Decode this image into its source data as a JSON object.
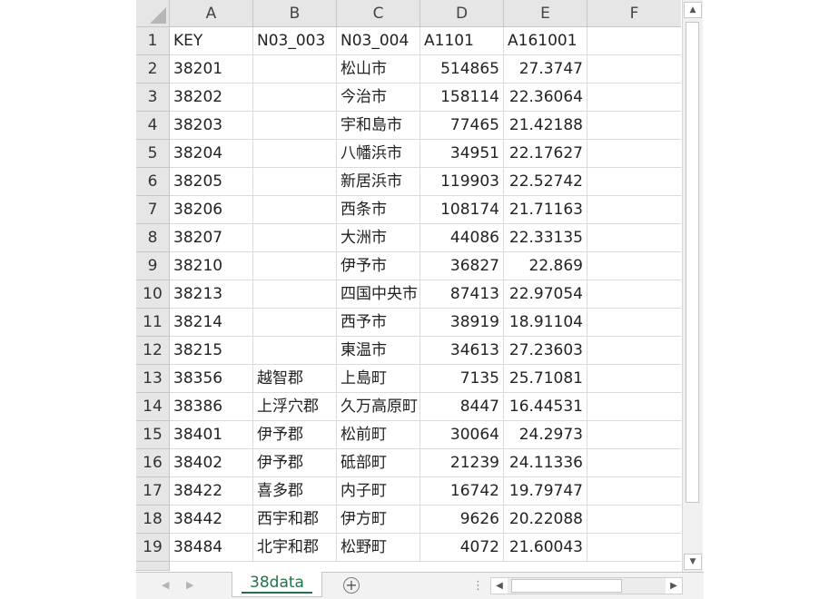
{
  "spreadsheet": {
    "columns": [
      "A",
      "B",
      "C",
      "D",
      "E",
      "F"
    ],
    "rows": [
      {
        "num": "1",
        "a": "KEY",
        "b": "N03_003",
        "c": "N03_004",
        "d": "A1101",
        "e": "A161001"
      },
      {
        "num": "2",
        "a": "38201",
        "b": "",
        "c": "松山市",
        "d": "514865",
        "e": "27.3747"
      },
      {
        "num": "3",
        "a": "38202",
        "b": "",
        "c": "今治市",
        "d": "158114",
        "e": "22.36064"
      },
      {
        "num": "4",
        "a": "38203",
        "b": "",
        "c": "宇和島市",
        "d": "77465",
        "e": "21.42188"
      },
      {
        "num": "5",
        "a": "38204",
        "b": "",
        "c": "八幡浜市",
        "d": "34951",
        "e": "22.17627"
      },
      {
        "num": "6",
        "a": "38205",
        "b": "",
        "c": "新居浜市",
        "d": "119903",
        "e": "22.52742"
      },
      {
        "num": "7",
        "a": "38206",
        "b": "",
        "c": "西条市",
        "d": "108174",
        "e": "21.71163"
      },
      {
        "num": "8",
        "a": "38207",
        "b": "",
        "c": "大洲市",
        "d": "44086",
        "e": "22.33135"
      },
      {
        "num": "9",
        "a": "38210",
        "b": "",
        "c": "伊予市",
        "d": "36827",
        "e": "22.869"
      },
      {
        "num": "10",
        "a": "38213",
        "b": "",
        "c": "四国中央市",
        "d": "87413",
        "e": "22.97054"
      },
      {
        "num": "11",
        "a": "38214",
        "b": "",
        "c": "西予市",
        "d": "38919",
        "e": "18.91104"
      },
      {
        "num": "12",
        "a": "38215",
        "b": "",
        "c": "東温市",
        "d": "34613",
        "e": "27.23603"
      },
      {
        "num": "13",
        "a": "38356",
        "b": "越智郡",
        "c": "上島町",
        "d": "7135",
        "e": "25.71081"
      },
      {
        "num": "14",
        "a": "38386",
        "b": "上浮穴郡",
        "c": "久万高原町",
        "d": "8447",
        "e": "16.44531"
      },
      {
        "num": "15",
        "a": "38401",
        "b": "伊予郡",
        "c": "松前町",
        "d": "30064",
        "e": "24.2973"
      },
      {
        "num": "16",
        "a": "38402",
        "b": "伊予郡",
        "c": "砥部町",
        "d": "21239",
        "e": "24.11336"
      },
      {
        "num": "17",
        "a": "38422",
        "b": "喜多郡",
        "c": "内子町",
        "d": "16742",
        "e": "19.79747"
      },
      {
        "num": "18",
        "a": "38442",
        "b": "西宇和郡",
        "c": "伊方町",
        "d": "9626",
        "e": "20.22088"
      },
      {
        "num": "19",
        "a": "38484",
        "b": "北宇和郡",
        "c": "松野町",
        "d": "4072",
        "e": "21.60043"
      }
    ]
  },
  "tabs": {
    "active_sheet": "38data",
    "add_symbol": "+",
    "separator": "⋮"
  },
  "scrollbar": {
    "up_arrow": "▲",
    "down_arrow": "▼",
    "left_arrow": "◀",
    "right_arrow": "▶"
  },
  "colors": {
    "accent": "#217346",
    "header_bg": "#e6e6e6",
    "gridline": "#dadada"
  }
}
